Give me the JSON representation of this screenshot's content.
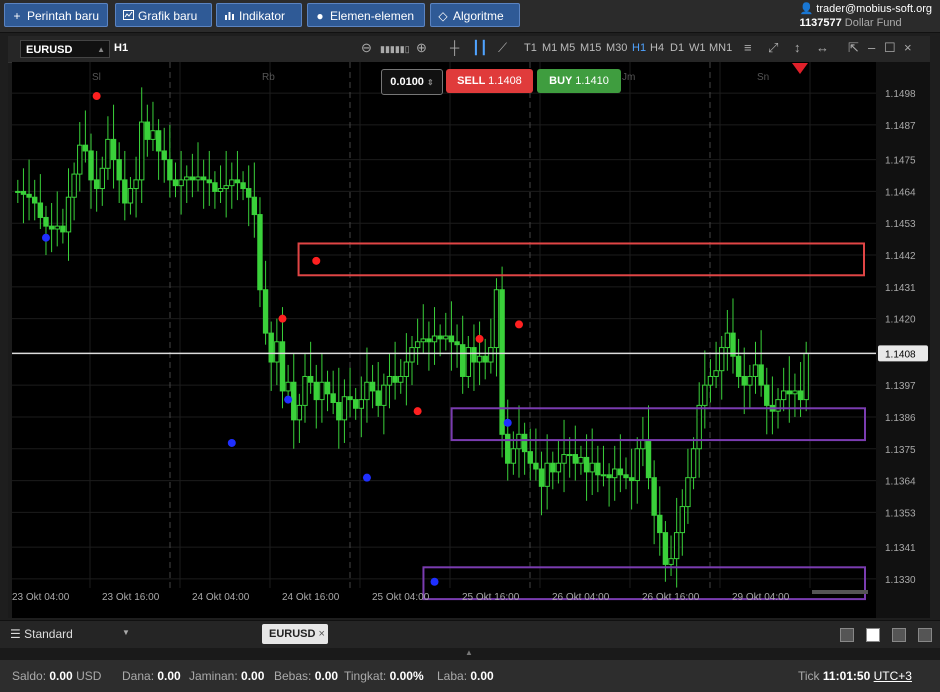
{
  "toolbar": {
    "new_order": "Perintah baru",
    "new_chart": "Grafik baru",
    "indicator": "Indikator",
    "elements": "Elemen-elemen",
    "algorithm": "Algoritme"
  },
  "user": {
    "email": "trader@mobius-soft.org",
    "account": "1137577",
    "fund": "Dollar Fund"
  },
  "chart": {
    "symbol": "EURUSD",
    "timeframe": "H1",
    "timeframes": [
      "T1",
      "M1",
      "M5",
      "M15",
      "M30",
      "H1",
      "H4",
      "D1",
      "W1",
      "MN1"
    ],
    "active_timeframe": "H1",
    "volume": "0.0100",
    "sell_label": "SELL",
    "sell_price": "1.1408",
    "buy_label": "BUY",
    "buy_price": "1.1410",
    "current_price_label": "1.1408",
    "day_labels": [
      "Sl",
      "Rb",
      "",
      "Jm",
      "Sn"
    ],
    "y_ticks": [
      "1.1498",
      "1.1487",
      "1.1475",
      "1.1464",
      "1.1453",
      "1.1442",
      "1.1431",
      "1.1420",
      "1.1408",
      "1.1397",
      "1.1386",
      "1.1375",
      "1.1364",
      "1.1353",
      "1.1341",
      "1.1330"
    ],
    "x_ticks": [
      "23 Okt 04:00",
      "23 Okt 16:00",
      "24 Okt 04:00",
      "24 Okt 16:00",
      "25 Okt 04:00",
      "25 Okt 16:00",
      "26 Okt 04:00",
      "26 Okt 16:00",
      "29 Okt 04:00"
    ],
    "colors": {
      "bull": "#3ad13a",
      "bear": "#3ad13a",
      "red_dot": "#ff2020",
      "blue_dot": "#1f2fff",
      "resistance_box": "#e04545",
      "support_box": "#7a3cb0"
    }
  },
  "chart_data": {
    "type": "candlestick",
    "y_range": [
      1.1322,
      1.1506
    ],
    "closes": [
      1.1464,
      1.1463,
      1.1462,
      1.146,
      1.1455,
      1.1452,
      1.1451,
      1.1452,
      1.145,
      1.1462,
      1.147,
      1.148,
      1.1478,
      1.1468,
      1.1465,
      1.1472,
      1.1482,
      1.1475,
      1.1468,
      1.146,
      1.1465,
      1.1468,
      1.1488,
      1.1482,
      1.1485,
      1.1478,
      1.1475,
      1.1468,
      1.1466,
      1.1468,
      1.1469,
      1.1468,
      1.1469,
      1.1468,
      1.1467,
      1.1464,
      1.1465,
      1.1466,
      1.1468,
      1.1467,
      1.1465,
      1.1462,
      1.1456,
      1.143,
      1.1415,
      1.1405,
      1.1412,
      1.1395,
      1.1398,
      1.1385,
      1.139,
      1.14,
      1.1398,
      1.1392,
      1.1398,
      1.1394,
      1.1391,
      1.1385,
      1.1393,
      1.1392,
      1.1389,
      1.1392,
      1.1398,
      1.1395,
      1.139,
      1.1397,
      1.14,
      1.1398,
      1.14,
      1.1405,
      1.141,
      1.1412,
      1.1413,
      1.1412,
      1.1414,
      1.1413,
      1.1414,
      1.1412,
      1.1411,
      1.14,
      1.141,
      1.1405,
      1.1407,
      1.1405,
      1.141,
      1.143,
      1.138,
      1.137,
      1.1375,
      1.138,
      1.1374,
      1.137,
      1.1368,
      1.1362,
      1.137,
      1.1367,
      1.137,
      1.1373,
      1.1373,
      1.137,
      1.1372,
      1.1367,
      1.137,
      1.1366,
      1.1366,
      1.1365,
      1.1368,
      1.1366,
      1.1365,
      1.1364,
      1.1375,
      1.1378,
      1.1365,
      1.1352,
      1.1346,
      1.1335,
      1.1337,
      1.1346,
      1.1355,
      1.1365,
      1.1375,
      1.139,
      1.1397,
      1.14,
      1.1402,
      1.141,
      1.1415,
      1.1407,
      1.14,
      1.1397,
      1.14,
      1.1404,
      1.1397,
      1.139,
      1.1388,
      1.1392,
      1.1395,
      1.1394,
      1.1395,
      1.1392,
      1.1408
    ],
    "red_markers": [
      {
        "i": 14,
        "y": 1.1497
      },
      {
        "i": 47,
        "y": 1.142
      },
      {
        "i": 53,
        "y": 1.144
      },
      {
        "i": 71,
        "y": 1.1388
      },
      {
        "i": 82,
        "y": 1.1413
      },
      {
        "i": 89,
        "y": 1.1418
      }
    ],
    "blue_markers": [
      {
        "i": 5,
        "y": 1.1448
      },
      {
        "i": 38,
        "y": 1.1377
      },
      {
        "i": 48,
        "y": 1.1392
      },
      {
        "i": 62,
        "y": 1.1365
      },
      {
        "i": 74,
        "y": 1.1329
      },
      {
        "i": 87,
        "y": 1.1384
      }
    ],
    "resistance_zone": {
      "y_top": 1.1446,
      "y_bottom": 1.1435,
      "i_start": 50,
      "i_end": 96
    },
    "support_zones": [
      {
        "y_top": 1.1389,
        "y_bottom": 1.1378,
        "i_start": 77,
        "i_end": 96
      },
      {
        "y_top": 1.1334,
        "y_bottom": 1.1323,
        "i_start": 72,
        "i_end": 96
      }
    ],
    "current_price": 1.1408
  },
  "bottom": {
    "layout": "Standard",
    "tab": "EURUSD"
  },
  "status": {
    "saldo_label": "Saldo:",
    "saldo": "0.00",
    "currency": "USD",
    "dana_label": "Dana:",
    "dana": "0.00",
    "jaminan_label": "Jaminan:",
    "jaminan": "0.00",
    "bebas_label": "Bebas:",
    "bebas": "0.00",
    "tingkat_label": "Tingkat:",
    "tingkat": "0.00%",
    "laba_label": "Laba:",
    "laba": "0.00",
    "tick_label": "Tick",
    "time": "11:01:50",
    "tz": "UTC+3"
  }
}
